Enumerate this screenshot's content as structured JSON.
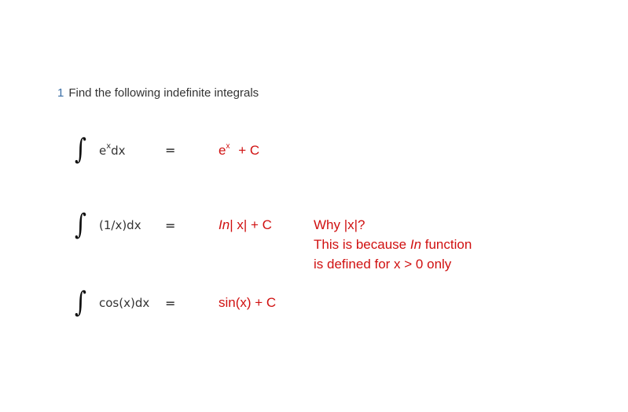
{
  "question": {
    "number": "1",
    "text": "Find the following indefinite integrals"
  },
  "integrals": [
    {
      "integrand_base": "e",
      "integrand_sup": "x",
      "integrand_rest": "dx",
      "equals": "=",
      "answer_base": "e",
      "answer_sup": "x",
      "answer_rest": "+ C"
    },
    {
      "integrand": "(1/x)dx",
      "equals": "=",
      "answer_fn": "In",
      "answer_rest": "| x|  + C",
      "note_lines": {
        "line1": "Why |x|?",
        "line2_prefix": "This is because ",
        "line2_fn": "In",
        "line2_suffix": " function",
        "line3": "is defined for x > 0 only"
      }
    },
    {
      "integrand": "cos(x)dx",
      "equals": "=",
      "answer": "sin(x)  + C"
    }
  ],
  "colors": {
    "answer": "#d01010",
    "question_number": "#3a6ea5"
  },
  "icons": {
    "integral": "integral-sign-icon"
  }
}
